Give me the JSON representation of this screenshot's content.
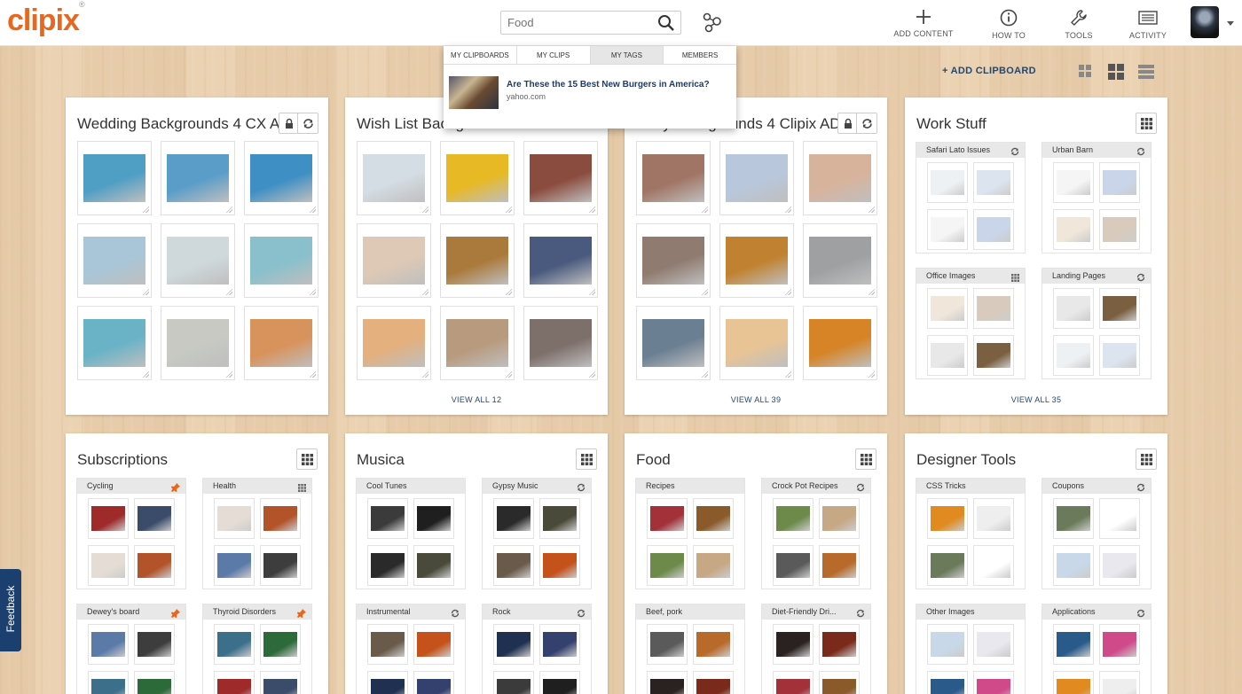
{
  "app": {
    "logo": "clipix",
    "logo_mark": "®"
  },
  "search": {
    "placeholder": "Food",
    "value": ""
  },
  "nav": [
    {
      "label": "ADD CONTENT",
      "icon": "plus-icon"
    },
    {
      "label": "HOW TO",
      "icon": "info-icon"
    },
    {
      "label": "TOOLS",
      "icon": "wrench-icon"
    },
    {
      "label": "ACTIVITY",
      "icon": "inbox-icon"
    }
  ],
  "dropdown": {
    "tabs": [
      "MY CLIPBOARDS",
      "MY CLIPS",
      "MY TAGS",
      "MEMBERS"
    ],
    "active_tab": "MY TAGS",
    "result": {
      "title": "Are These the 15 Best New Burgers in America?",
      "source": "yahoo.com"
    }
  },
  "toolbar": {
    "add_clipboard": "+ ADD CLIPBOARD"
  },
  "boards": [
    {
      "title": "Wedding Backgrounds 4 CX AD",
      "view_all": "",
      "colors": [
        "#4f9ec4",
        "#5a9dc8",
        "#3e8fc4",
        "#a9c6d8",
        "#cfd9dc",
        "#89c0cc",
        "#6ab3c7",
        "#c7c9c2",
        "#d8925b"
      ]
    },
    {
      "title": "Wish List Backgrounds 4 CX AD",
      "view_all": "VIEW ALL 12",
      "colors": [
        "#d4dde3",
        "#e7b924",
        "#8a4c3e",
        "#dec9b6",
        "#aa7a3c",
        "#4a5a7e",
        "#e3b07e",
        "#b89a7e",
        "#7d6f6a"
      ]
    },
    {
      "title": "Baby Backgrounds 4 Clipix AD",
      "view_all": "VIEW ALL 39",
      "colors": [
        "#a07565",
        "#b9c7dc",
        "#d8b39c",
        "#8f7b70",
        "#c08230",
        "#9ea0a2",
        "#6b7f92",
        "#e8c495",
        "#d68426"
      ]
    },
    {
      "title": "Work Stuff",
      "view_all": "VIEW ALL 35"
    },
    {
      "title": "Subscriptions"
    },
    {
      "title": "Musica"
    },
    {
      "title": "Food"
    },
    {
      "title": "Designer Tools"
    }
  ],
  "subboards": {
    "work_stuff": [
      "Safari Lato Issues",
      "Urban Barn",
      "Office Images",
      "Landing Pages"
    ],
    "subscriptions": [
      "Cycling",
      "Health",
      "Dewey's board",
      "Thyroid Disorders"
    ],
    "musica": [
      "Cool Tunes",
      "Gypsy Music",
      "Instrumental",
      "Rock"
    ],
    "food": [
      "Recipes",
      "Crock Pot Recipes",
      "Beef, pork",
      "Diet-Friendly Dri..."
    ],
    "designer_tools": [
      "CSS Tricks",
      "Coupons",
      "Other Images",
      "Applications"
    ]
  },
  "feedback": "Feedback"
}
